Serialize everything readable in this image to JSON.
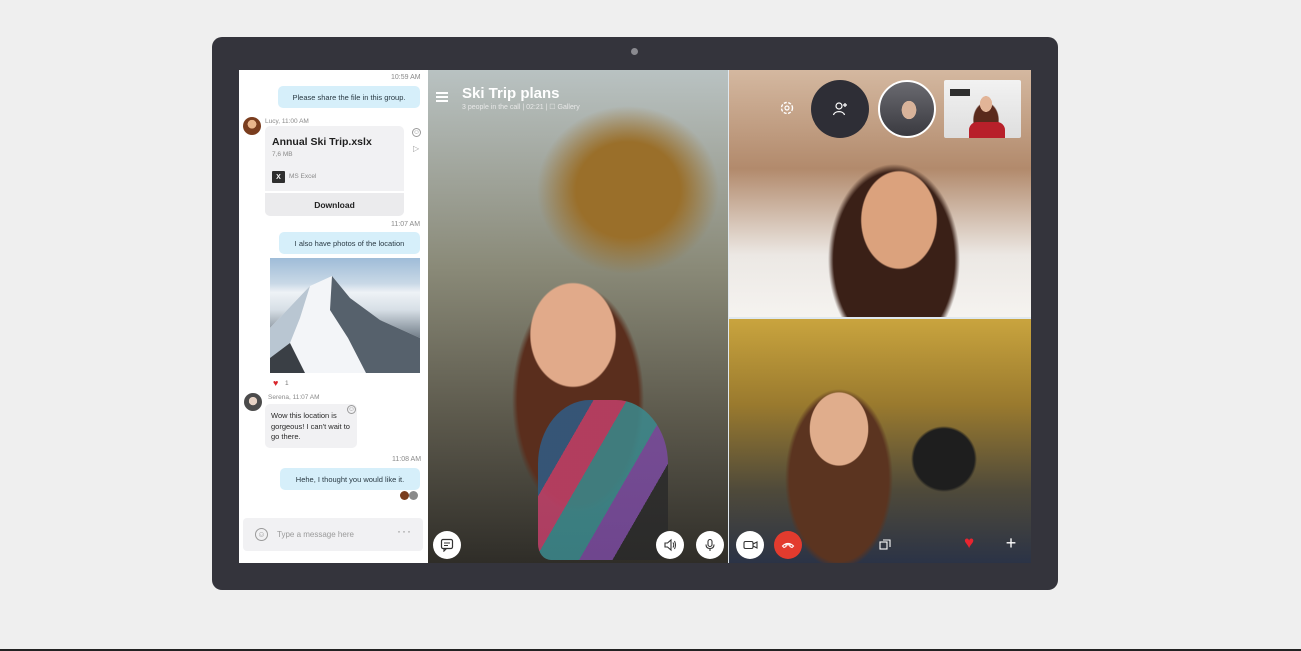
{
  "chat": {
    "messages": [
      {
        "time": "10:59 AM",
        "text": "Please share the file in this group."
      },
      {
        "time": "11:07 AM",
        "text": "I also have photos of the location"
      },
      {
        "time": "11:08 AM",
        "text": "Hehe, I thought you would like it."
      }
    ],
    "lucy": {
      "sender": "Lucy, 11:00 AM",
      "file_name": "Annual Ski Trip.xslx",
      "file_size": "7,6 MB",
      "file_type": "MS Excel",
      "download_label": "Download"
    },
    "photo_reaction_count": "1",
    "serena": {
      "sender": "Serena, 11:07 AM",
      "text": "Wow this location is gorgeous! I can't wait to go there."
    },
    "compose": {
      "placeholder": "Type a message here",
      "more": "···"
    }
  },
  "call": {
    "title": "Ski Trip plans",
    "subtitle": "3 people in the call | 02:21 | ☐ Gallery"
  },
  "icons": {
    "menu": "hamburger-menu-icon",
    "settings": "gear-icon",
    "add_people": "add-person-icon",
    "chat": "chat-bubble-icon",
    "speaker": "speaker-icon",
    "mic": "microphone-icon",
    "video": "video-camera-icon",
    "end_call": "hang-up-icon",
    "screen_share": "screen-share-icon",
    "heart": "heart-icon",
    "add": "plus-icon"
  },
  "colors": {
    "device": "#34343c",
    "outgoing_bubble": "#d6effa",
    "end_call": "#e33b2e",
    "heart": "#e8242f"
  }
}
